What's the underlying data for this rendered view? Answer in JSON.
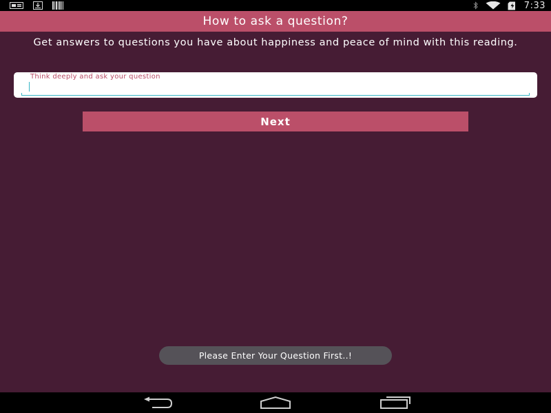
{
  "status_bar": {
    "time": "7:33",
    "left_icons": [
      "notification-card-icon",
      "download-icon",
      "barcode-icon"
    ],
    "right_icons": [
      "bluetooth-icon",
      "wifi-icon",
      "battery-charging-icon"
    ]
  },
  "header": {
    "title": "How to ask a question?"
  },
  "main": {
    "description": "Get answers to questions you have about happiness and peace of mind with this reading.",
    "question_field": {
      "label": "Think deeply and ask your question",
      "value": "",
      "placeholder": ""
    },
    "next_label": "Next"
  },
  "toast": {
    "message": "Please Enter Your Question First..!"
  },
  "nav_bar": {
    "buttons": [
      "back-icon",
      "home-icon",
      "recent-apps-icon"
    ]
  },
  "colors": {
    "background": "#461c34",
    "accent": "#bb4f69",
    "input_focus": "#35b4c4",
    "toast": "#555258"
  }
}
